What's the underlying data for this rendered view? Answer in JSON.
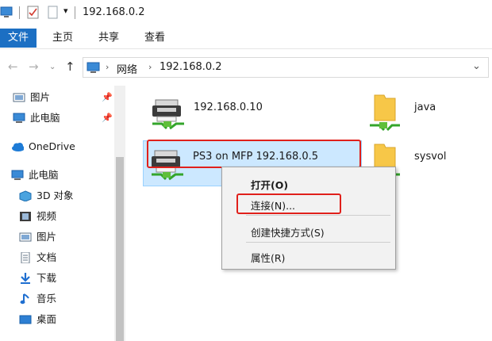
{
  "window": {
    "title": "192.168.0.2"
  },
  "ribbon": {
    "tabs": [
      "文件",
      "主页",
      "共享",
      "查看"
    ]
  },
  "address": {
    "crumbs": [
      "网络",
      "192.168.0.2"
    ]
  },
  "nav": {
    "quick_access": [
      {
        "label": "图片",
        "icon": "pictures-icon"
      },
      {
        "label": "此电脑",
        "icon": "pc-icon"
      }
    ],
    "onedrive": "OneDrive",
    "this_pc": "此电脑",
    "children": [
      {
        "label": "3D 对象",
        "icon": "3d-objects-icon"
      },
      {
        "label": "视频",
        "icon": "video-icon"
      },
      {
        "label": "图片",
        "icon": "pictures-icon"
      },
      {
        "label": "文档",
        "icon": "documents-icon"
      },
      {
        "label": "下载",
        "icon": "download-icon"
      },
      {
        "label": "音乐",
        "icon": "music-icon"
      },
      {
        "label": "桌面",
        "icon": "desktop-icon"
      }
    ]
  },
  "items": [
    {
      "name": "192.168.0.10",
      "type": "printer"
    },
    {
      "name": "java",
      "type": "folder"
    },
    {
      "name": "PS3 on MFP 192.168.0.5",
      "type": "printer",
      "selected": true
    },
    {
      "name": "sysvol",
      "type": "folder"
    }
  ],
  "context_menu": {
    "open": "打开(O)",
    "connect": "连接(N)...",
    "create_shortcut": "创建快捷方式(S)",
    "properties": "属性(R)"
  },
  "colors": {
    "accent": "#1c6fc3",
    "highlight": "#e0201b",
    "selection": "#cce8ff"
  }
}
